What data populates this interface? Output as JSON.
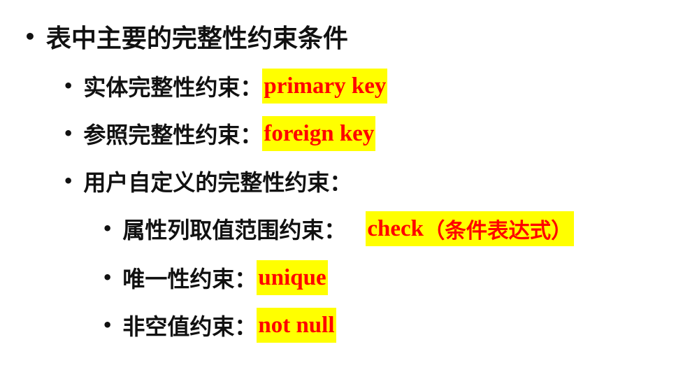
{
  "slide": {
    "bullet_char": "•",
    "title": "表中主要的完整性约束条件",
    "items": [
      {
        "label": "实体完整性约束：",
        "value": "primary key"
      },
      {
        "label": "参照完整性约束：",
        "value": "foreign key"
      },
      {
        "label": "用户自定义的完整性约束：",
        "subitems": [
          {
            "label": "属性列取值范围约束：",
            "value": "check",
            "value_extra": "（条件表达式）"
          },
          {
            "label": "唯一性约束：",
            "value": "unique"
          },
          {
            "label": "非空值约束：",
            "value": "not null"
          }
        ]
      }
    ]
  },
  "colors": {
    "text": "#111111",
    "highlight_bg": "#ffff00",
    "highlight_text": "#ff0000",
    "background": "#ffffff"
  }
}
